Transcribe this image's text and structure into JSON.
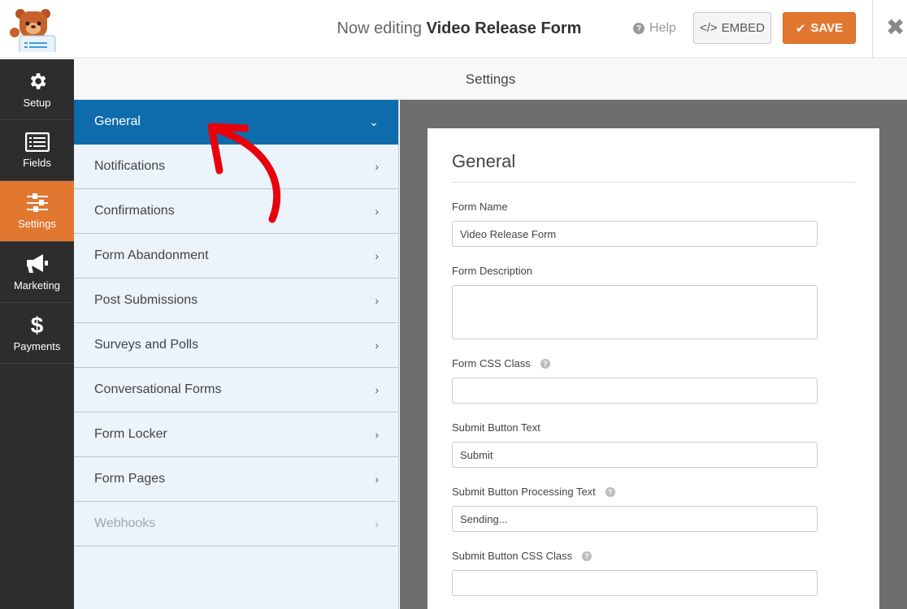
{
  "header": {
    "title_prefix": "Now editing",
    "form_name": "Video Release Form",
    "help_label": "Help",
    "embed_label": "EMBED",
    "save_label": "SAVE",
    "close_icon": "close-icon",
    "colors": {
      "save": "#e27730",
      "active_panel": "#0e6cad"
    }
  },
  "sidebar": {
    "items": [
      {
        "label": "Setup",
        "icon": "gear-icon",
        "active": false
      },
      {
        "label": "Fields",
        "icon": "list-icon",
        "active": false
      },
      {
        "label": "Settings",
        "icon": "sliders-icon",
        "active": true
      },
      {
        "label": "Marketing",
        "icon": "megaphone-icon",
        "active": false
      },
      {
        "label": "Payments",
        "icon": "dollar-icon",
        "active": false
      }
    ]
  },
  "settings": {
    "header": "Settings",
    "panels": [
      {
        "label": "General",
        "state": "active"
      },
      {
        "label": "Notifications",
        "state": "normal"
      },
      {
        "label": "Confirmations",
        "state": "normal"
      },
      {
        "label": "Form Abandonment",
        "state": "normal"
      },
      {
        "label": "Post Submissions",
        "state": "normal"
      },
      {
        "label": "Surveys and Polls",
        "state": "normal"
      },
      {
        "label": "Conversational Forms",
        "state": "normal"
      },
      {
        "label": "Form Locker",
        "state": "normal"
      },
      {
        "label": "Form Pages",
        "state": "normal"
      },
      {
        "label": "Webhooks",
        "state": "disabled"
      }
    ]
  },
  "general": {
    "title": "General",
    "fields": {
      "form_name": {
        "label": "Form Name",
        "value": "Video Release Form"
      },
      "form_description": {
        "label": "Form Description",
        "value": ""
      },
      "form_css_class": {
        "label": "Form CSS Class",
        "value": ""
      },
      "submit_text": {
        "label": "Submit Button Text",
        "value": "Submit"
      },
      "submit_processing": {
        "label": "Submit Button Processing Text",
        "value": "Sending..."
      },
      "submit_css_class": {
        "label": "Submit Button CSS Class",
        "value": ""
      }
    }
  }
}
